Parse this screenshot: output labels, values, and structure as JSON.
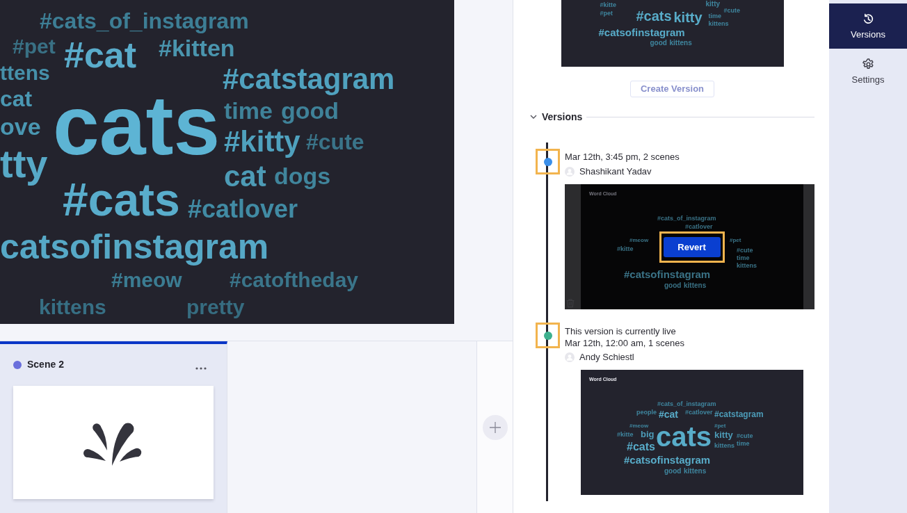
{
  "canvas": {
    "words": [
      {
        "text": "#cats_of_instagram",
        "color": "#3d7e95"
      },
      {
        "text": "#pet",
        "color": "#397084"
      },
      {
        "text": "#kitten",
        "color": "#4a95ae"
      },
      {
        "text": "ttens",
        "color": "#4690aa"
      },
      {
        "text": "#cat",
        "color": "#5aaccb"
      },
      {
        "text": "#catstagram",
        "color": "#50a2bf"
      },
      {
        "text": "cat",
        "color": "#4a97b2"
      },
      {
        "text": "cats",
        "color": "#5db4d4"
      },
      {
        "text": "time",
        "color": "#3f8299"
      },
      {
        "text": "good",
        "color": "#3f8299"
      },
      {
        "text": "ove",
        "color": "#4a97b2"
      },
      {
        "text": "#kitty",
        "color": "#4fa1be"
      },
      {
        "text": "#cute",
        "color": "#3a7489"
      },
      {
        "text": "tty",
        "color": "#57a9c7"
      },
      {
        "text": "#cats",
        "color": "#59adcc"
      },
      {
        "text": "cat",
        "color": "#4d9bb6"
      },
      {
        "text": "dogs",
        "color": "#40859c"
      },
      {
        "text": "#catlover",
        "color": "#418ba4"
      },
      {
        "text": "catsofinstagram",
        "color": "#56a8c6"
      },
      {
        "text": "#meow",
        "color": "#3b7c92"
      },
      {
        "text": "#catoftheday",
        "color": "#3a758a"
      },
      {
        "text": "kittens",
        "color": "#376f84"
      },
      {
        "text": "pretty",
        "color": "#366c80"
      }
    ]
  },
  "scenes": [
    {
      "name": "Scene 2",
      "color": "#6a6fdc",
      "selected": true
    }
  ],
  "panel": {
    "preview": {
      "words": [
        "#kitte",
        "#pet",
        "kitty",
        "#cute",
        "#cats",
        "kitty",
        "time",
        "kittens",
        "#catsofinstagram",
        "good",
        "kittens"
      ]
    },
    "create_button": {
      "label": "Create Version",
      "disabled": true
    },
    "section": {
      "title": "Versions",
      "expanded": true
    },
    "versions": [
      {
        "color": "#3a8fea",
        "dot_highlighted": true,
        "date": "Mar 12th, 3:45 pm, 2 scenes",
        "author": "Shashikant Yadav",
        "hovered": true,
        "preview": {
          "title": "Word Cloud",
          "words": [
            "#cats_of_instagram",
            "#catlover",
            "#meow",
            "#kitte",
            "#pet",
            "#cute",
            "time",
            "kittens",
            "#catsofinstagram",
            "good",
            "kittens"
          ]
        },
        "revert": {
          "label": "Revert",
          "highlighted": true
        }
      },
      {
        "color": "#3db08e",
        "dot_highlighted": true,
        "status": "This version is currently live",
        "date": "Mar 12th, 12:00 am, 1 scenes",
        "author": "Andy Schiestl",
        "hovered": false,
        "preview": {
          "title": "Word Cloud",
          "words": [
            "#cats_of_instagram",
            "people",
            "#cat",
            "#catlover",
            "#catstagram",
            "#meow",
            "#pet",
            "#kitte",
            "big",
            "cats",
            "kitty",
            "#cute",
            "#cats",
            "kittens",
            "time",
            "#catsofinstagram",
            "good",
            "kittens"
          ]
        }
      }
    ]
  },
  "sidebar": {
    "tabs": [
      {
        "label": "Versions",
        "selected": true
      },
      {
        "label": "Settings",
        "selected": false
      }
    ]
  }
}
